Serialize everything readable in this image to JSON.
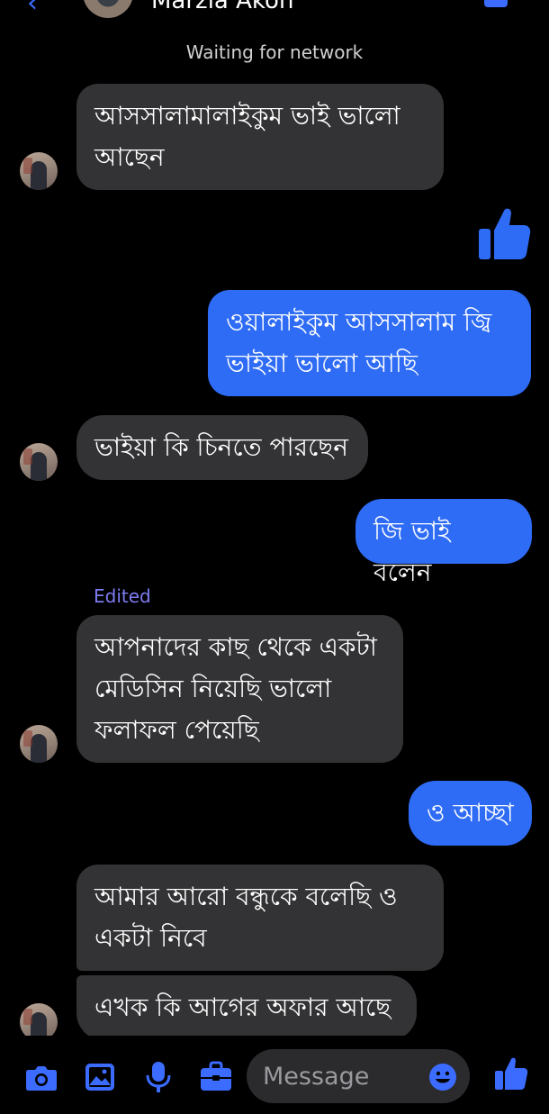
{
  "header": {
    "contact_name": "Marzia Akon"
  },
  "status_text": "Waiting for network",
  "messages": [
    {
      "from": "them",
      "lines": [
        "আসসালামালাইকুম ভাই ভালো",
        "আছেন"
      ]
    },
    {
      "from": "me",
      "type": "like"
    },
    {
      "from": "me",
      "lines": [
        "ওয়ালাইকুম আসসালাম জ্বি",
        "ভাইয়া ভালো আছি"
      ]
    },
    {
      "from": "them",
      "lines": [
        "ভাইয়া কি চিনতে পারছেন"
      ]
    },
    {
      "from": "me",
      "lines": [
        "জি ভাই বলেন"
      ]
    },
    {
      "from": "them",
      "edited_label": "Edited",
      "lines": [
        "আপনাদের কাছ থেকে একটা",
        "মেডিসিন নিয়েছি ভালো",
        "ফলাফল পেয়েছি"
      ]
    },
    {
      "from": "me",
      "lines": [
        "ও আচ্ছা"
      ]
    },
    {
      "from": "them",
      "lines": [
        "আমার আরো বন্ধুকে বলেছি ও",
        "একটা নিবে"
      ]
    },
    {
      "from": "them",
      "lines": [
        "এখক কি আগের অফার আছে"
      ]
    }
  ],
  "composer": {
    "placeholder": "Message",
    "icons": [
      "camera-icon",
      "gallery-icon",
      "microphone-icon",
      "briefcase-icon",
      "emoji-icon",
      "like-icon"
    ]
  },
  "colors": {
    "accent": "#2f6cf5",
    "incoming_bubble": "#333335",
    "background": "#000000",
    "edited_label": "#7d7cf3"
  }
}
